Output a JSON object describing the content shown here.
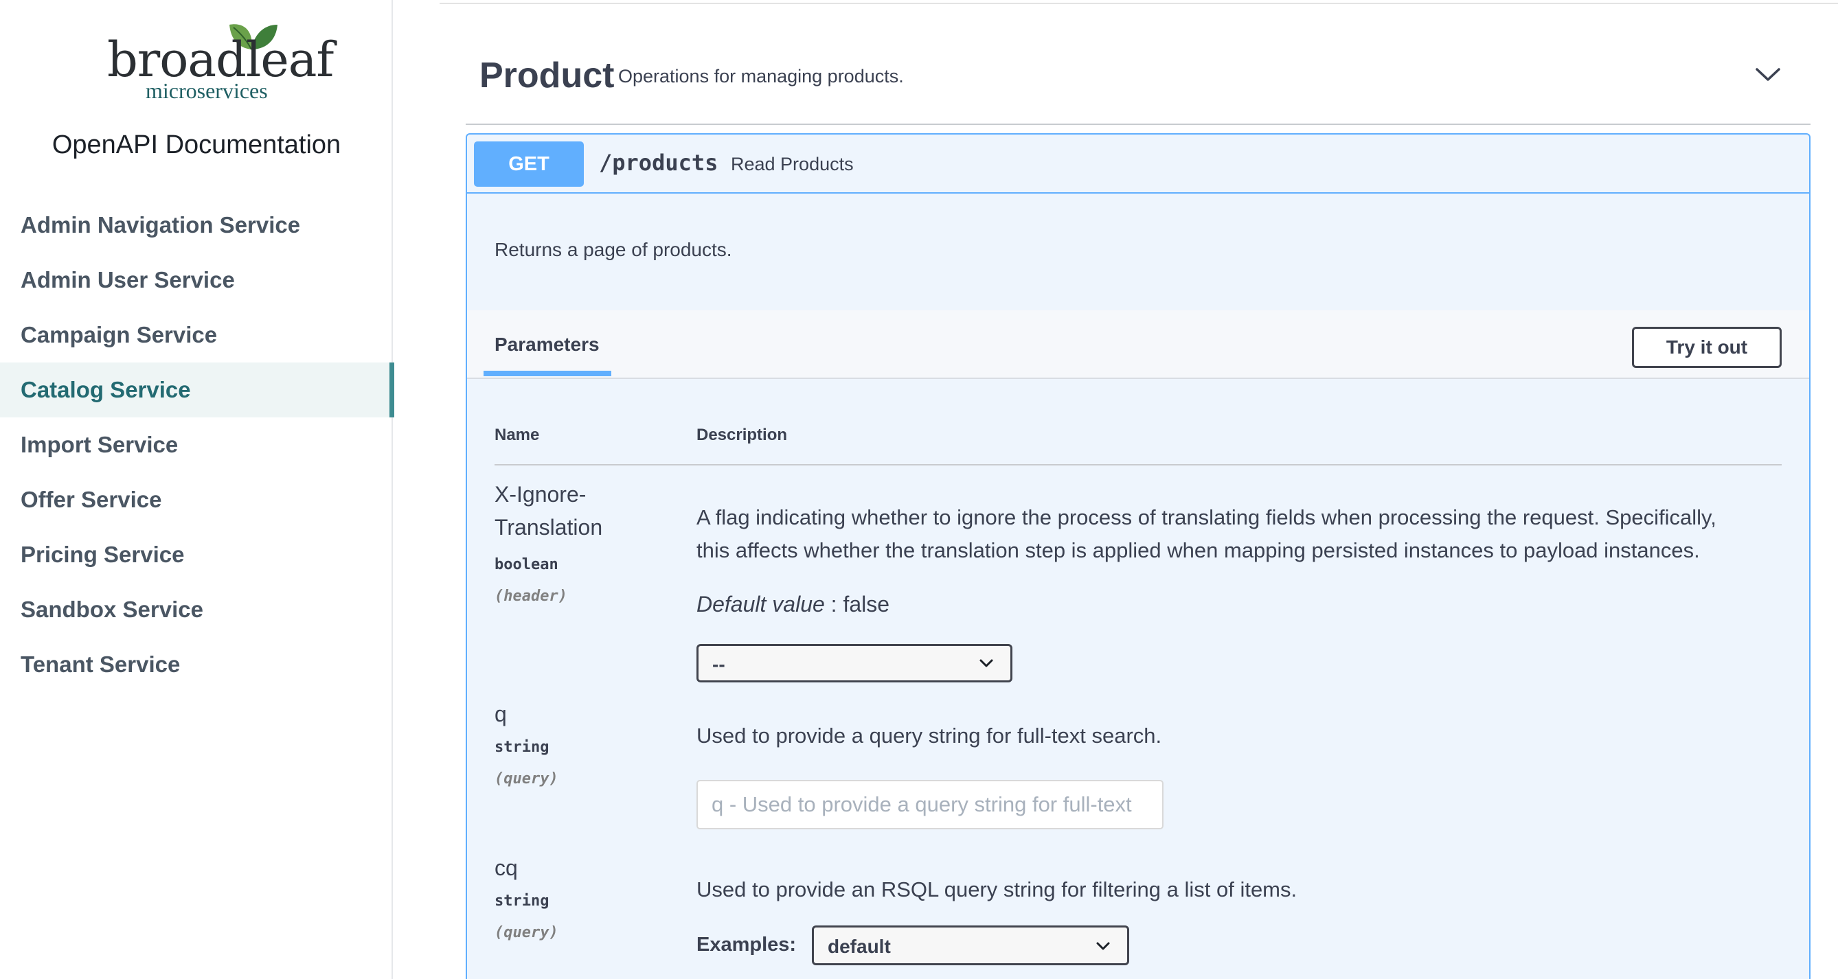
{
  "sidebar": {
    "logo": {
      "word": "broadleaf",
      "sub": "microservices"
    },
    "title": "OpenAPI Documentation",
    "items": [
      {
        "label": "Admin Navigation Service",
        "active": false
      },
      {
        "label": "Admin User Service",
        "active": false
      },
      {
        "label": "Campaign Service",
        "active": false
      },
      {
        "label": "Catalog Service",
        "active": true
      },
      {
        "label": "Import Service",
        "active": false
      },
      {
        "label": "Offer Service",
        "active": false
      },
      {
        "label": "Pricing Service",
        "active": false
      },
      {
        "label": "Sandbox Service",
        "active": false
      },
      {
        "label": "Tenant Service",
        "active": false
      }
    ]
  },
  "tag": {
    "name": "Product",
    "description": "Operations for managing products.",
    "icon": "chevron-down-icon"
  },
  "operation": {
    "method": "GET",
    "path": "/products",
    "summary": "Read Products",
    "description": "Returns a page of products."
  },
  "parameters": {
    "tab_label": "Parameters",
    "try_label": "Try it out",
    "col_name": "Name",
    "col_description": "Description",
    "items": [
      {
        "name_line1": "X-Ignore-",
        "name_line2": "Translation",
        "type": "boolean",
        "in": "(header)",
        "desc_line1": "A flag indicating whether to ignore the process of translating fields when processing the request. Specifically,",
        "desc_line2": "this affects whether the translation step is applied when mapping persisted instances to payload instances.",
        "default_label": "Default value",
        "default_value": " : false",
        "select_value": "--"
      },
      {
        "name": "q",
        "type": "string",
        "in": "(query)",
        "desc": "Used to provide a query string for full-text search.",
        "placeholder": "q - Used to provide a query string for full-text"
      },
      {
        "name": "cq",
        "type": "string",
        "in": "(query)",
        "desc": "Used to provide an RSQL query string for filtering a list of items.",
        "examples_label": "Examples:",
        "examples_value": "default"
      }
    ]
  },
  "colors": {
    "get_method": "#61affe",
    "opblock_bg": "#eef5fd",
    "active_nav": "#236a72",
    "active_bar": "#3e8c91"
  }
}
